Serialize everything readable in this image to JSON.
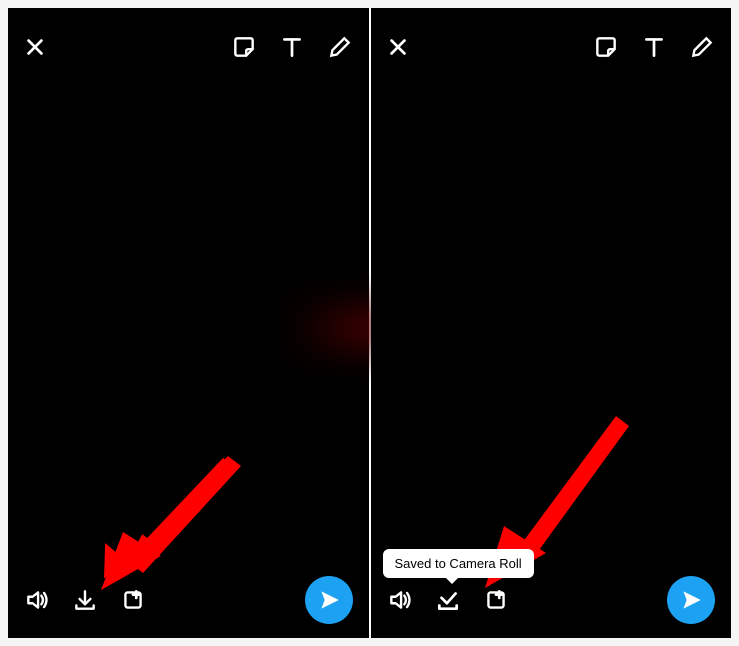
{
  "left_screen": {
    "top": {
      "close": "close",
      "sticker": "sticker",
      "text_tool": "text",
      "draw": "draw"
    },
    "bottom": {
      "audio": "audio",
      "save": "save",
      "story": "add-to-story",
      "send": "send"
    }
  },
  "right_screen": {
    "top": {
      "close": "close",
      "sticker": "sticker",
      "text_tool": "text",
      "draw": "draw"
    },
    "bottom": {
      "audio": "audio",
      "saved": "saved",
      "story": "add-to-story",
      "send": "send"
    },
    "tooltip": "Saved to Camera Roll"
  },
  "annotations": {
    "arrow_color": "#ff0000"
  }
}
